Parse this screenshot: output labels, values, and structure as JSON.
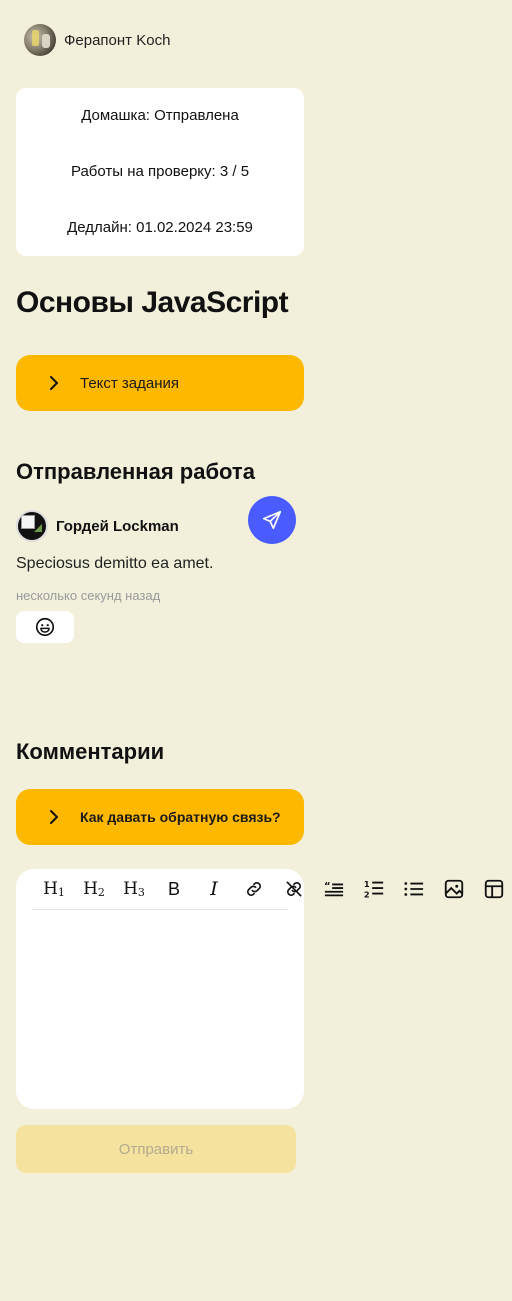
{
  "user": {
    "name": "Ферапонт Koch",
    "avatar_icon": "user-avatar"
  },
  "status": {
    "homework": "Домашка: Отправлена",
    "reviews": "Работы на проверку: 3 / 5",
    "deadline": "Дедлайн: 01.02.2024 23:59"
  },
  "task": {
    "title": "Основы JavaScript",
    "accordion_label": "Текст задания"
  },
  "submitted": {
    "heading": "Отправленная работа",
    "author": "Гордей Lockman",
    "text": "Speciosus demitto ea amet.",
    "time": "несколько секунд назад",
    "reaction_icon": "emoji-smile-icon"
  },
  "comments": {
    "heading": "Комментарии",
    "feedback_label": "Как давать обратную связь?"
  },
  "editor": {
    "toolbar": {
      "h1": "H",
      "h1_sub": "1",
      "h2": "H",
      "h2_sub": "2",
      "h3": "H",
      "h3_sub": "3",
      "bold": "B",
      "italic": "I"
    }
  },
  "submit": {
    "label": "Отправить"
  },
  "colors": {
    "background": "#f2efdb",
    "accent": "#ffb800",
    "fab": "#4a5cff",
    "submit_disabled": "#f6e29f"
  }
}
